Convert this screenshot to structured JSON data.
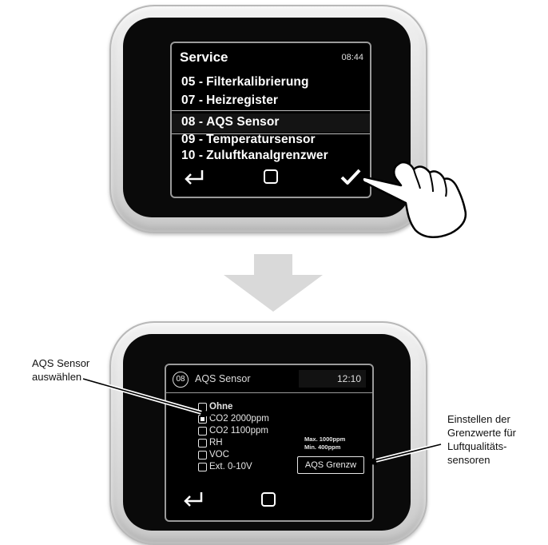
{
  "top_screen": {
    "title": "Service",
    "time": "08:44",
    "items": [
      {
        "num": "05 -",
        "label": "Filterkalibrierung"
      },
      {
        "num": "07 -",
        "label": "Heizregister"
      },
      {
        "num": "08 -",
        "label": "AQS Sensor"
      },
      {
        "num": "09 -",
        "label": "Temperatursensor"
      },
      {
        "num": "10 -",
        "label": "Zuluftkanalgrenzwer"
      }
    ],
    "selected_index": 2,
    "nav_icons": [
      "back-arrow-icon",
      "square-icon",
      "checkmark-icon"
    ]
  },
  "bottom_screen": {
    "badge": "08",
    "title": "AQS Sensor",
    "time": "12:10",
    "options": [
      {
        "label": "Ohne",
        "checked": false,
        "bold": true
      },
      {
        "label": "CO2 2000ppm",
        "checked": true,
        "bold": false
      },
      {
        "label": "CO2 1100ppm",
        "checked": false,
        "bold": false
      },
      {
        "label": "RH",
        "checked": false,
        "bold": false
      },
      {
        "label": "VOC",
        "checked": false,
        "bold": false
      },
      {
        "label": "Ext. 0-10V",
        "checked": false,
        "bold": false
      }
    ],
    "max_text": "Max. 1000ppm",
    "min_text": "Min. 400ppm",
    "button_label": "AQS Grenzw",
    "nav_icons": [
      "back-arrow-icon",
      "square-icon"
    ]
  },
  "annotations": {
    "left_line1": "AQS Sensor",
    "left_line2": "auswählen",
    "right_line1": "Einstellen der",
    "right_line2": "Grenzwerte für",
    "right_line3": "Luftqualitäts-",
    "right_line4": "sensoren"
  }
}
